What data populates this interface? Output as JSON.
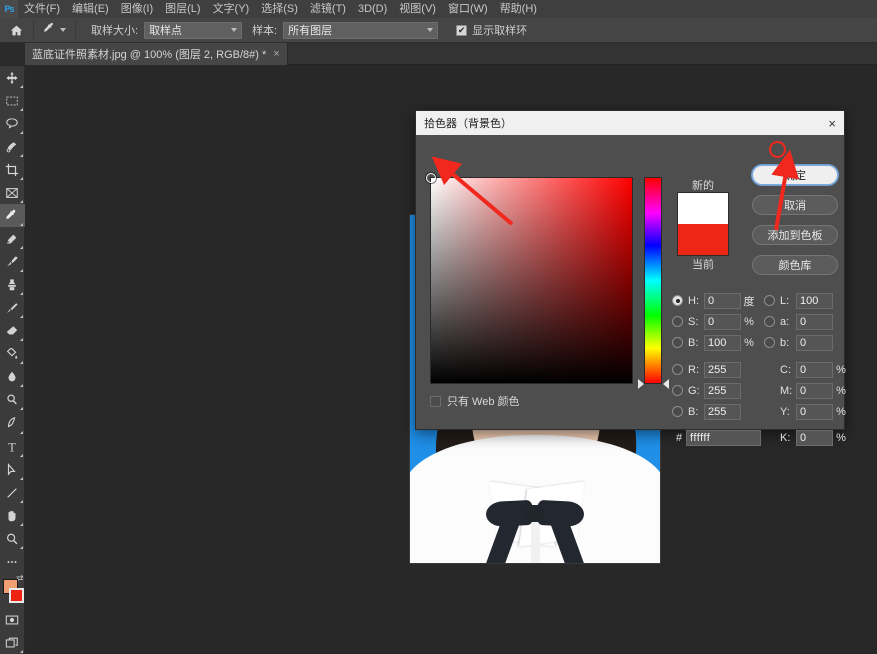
{
  "app": {
    "logo_text": "Ps"
  },
  "menubar": {
    "items": [
      {
        "label": "文件(F)"
      },
      {
        "label": "编辑(E)"
      },
      {
        "label": "图像(I)"
      },
      {
        "label": "图层(L)"
      },
      {
        "label": "文字(Y)"
      },
      {
        "label": "选择(S)"
      },
      {
        "label": "滤镜(T)"
      },
      {
        "label": "3D(D)"
      },
      {
        "label": "视图(V)"
      },
      {
        "label": "窗口(W)"
      },
      {
        "label": "帮助(H)"
      }
    ]
  },
  "optionsbar": {
    "home_icon": "home-icon",
    "tool_icon": "eyedropper-icon",
    "sample_size_label": "取样大小:",
    "sample_size_value": "取样点",
    "sample_label": "样本:",
    "sample_value": "所有图层",
    "show_ring_label": "显示取样环",
    "show_ring_checked": true,
    "check_glyph": "✔"
  },
  "document_tab": {
    "title": "蓝底证件照素材.jpg @ 100% (图层 2, RGB/8#) *",
    "close_glyph": "×"
  },
  "toolbar": {
    "tools": [
      {
        "name": "move-tool",
        "icon": "move-icon"
      },
      {
        "name": "rectangular-marquee-tool",
        "icon": "marquee-icon"
      },
      {
        "name": "lasso-tool",
        "icon": "lasso-icon"
      },
      {
        "name": "quick-selection-tool",
        "icon": "quick-select-icon"
      },
      {
        "name": "crop-tool",
        "icon": "crop-icon"
      },
      {
        "name": "frame-tool",
        "icon": "frame-icon"
      },
      {
        "name": "eyedropper-tool",
        "icon": "eyedropper-icon"
      },
      {
        "name": "spot-healing-tool",
        "icon": "healing-icon"
      },
      {
        "name": "brush-tool",
        "icon": "brush-icon"
      },
      {
        "name": "clone-stamp-tool",
        "icon": "clone-stamp-icon"
      },
      {
        "name": "history-brush-tool",
        "icon": "history-brush-icon"
      },
      {
        "name": "eraser-tool",
        "icon": "eraser-icon"
      },
      {
        "name": "gradient-tool",
        "icon": "paint-bucket-icon"
      },
      {
        "name": "blur-tool",
        "icon": "blur-drop-icon"
      },
      {
        "name": "dodge-tool",
        "icon": "dodge-icon"
      },
      {
        "name": "pen-tool",
        "icon": "pen-icon"
      },
      {
        "name": "type-tool",
        "icon": "type-icon"
      },
      {
        "name": "path-selection-tool",
        "icon": "path-arrow-icon"
      },
      {
        "name": "line-tool",
        "icon": "line-shape-icon"
      },
      {
        "name": "hand-tool",
        "icon": "hand-icon"
      },
      {
        "name": "zoom-tool",
        "icon": "magnifier-icon"
      },
      {
        "name": "edit-toolbar-button",
        "icon": "ellipsis-icon"
      }
    ],
    "active_tool_index": 6,
    "foreground_color": "#f0a070",
    "background_color": "#ee2211",
    "swap_glyph": "⇄",
    "quick_mask": {
      "name": "quick-mask-button",
      "icon": "quick-mask-icon"
    },
    "screen_mode": {
      "name": "screen-mode-button",
      "icon": "screen-mode-icon"
    }
  },
  "canvas": {
    "photo_background_color": "#1f8fe8",
    "shirt_color": "#fcfcfc",
    "tie_color": "#232830",
    "hair_color": "#241c19",
    "skin_color": "#f2cdb4"
  },
  "dialog": {
    "title": "拾色器（背景色）",
    "close_glyph": "×",
    "preview": {
      "new_label": "新的",
      "current_label": "当前",
      "new_color": "#ffffff",
      "current_color": "#ee2615"
    },
    "buttons": [
      {
        "label": "确定",
        "primary": true
      },
      {
        "label": "取消",
        "primary": false
      },
      {
        "label": "添加到色板",
        "primary": false
      },
      {
        "label": "颜色库",
        "primary": false
      }
    ],
    "web_only_label": "只有 Web 颜色",
    "web_only_checked": false,
    "fields": {
      "left": [
        {
          "label": "H:",
          "value": "0",
          "unit": "度",
          "selected": true
        },
        {
          "label": "S:",
          "value": "0",
          "unit": "%",
          "selected": false
        },
        {
          "label": "B:",
          "value": "100",
          "unit": "%",
          "selected": false
        },
        {
          "label": "R:",
          "value": "255",
          "unit": "",
          "selected": false
        },
        {
          "label": "G:",
          "value": "255",
          "unit": "",
          "selected": false
        },
        {
          "label": "B:",
          "value": "255",
          "unit": "",
          "selected": false
        }
      ],
      "right": [
        {
          "label": "L:",
          "value": "100",
          "unit": "",
          "radio": true,
          "selected": false
        },
        {
          "label": "a:",
          "value": "0",
          "unit": "",
          "radio": true,
          "selected": false
        },
        {
          "label": "b:",
          "value": "0",
          "unit": "",
          "radio": true,
          "selected": false
        },
        {
          "label": "C:",
          "value": "0",
          "unit": "%",
          "radio": false,
          "selected": false
        },
        {
          "label": "M:",
          "value": "0",
          "unit": "%",
          "radio": false,
          "selected": false
        },
        {
          "label": "Y:",
          "value": "0",
          "unit": "%",
          "radio": false,
          "selected": false
        },
        {
          "label": "K:",
          "value": "0",
          "unit": "%",
          "radio": false,
          "selected": false
        }
      ],
      "hex_label": "#",
      "hex_value": "ffffff"
    }
  },
  "annotations": {
    "arrow_color": "#f0281e",
    "arrow_sv_target": "white-corner-of-color-field",
    "arrow_ok_target": "ok-button"
  }
}
